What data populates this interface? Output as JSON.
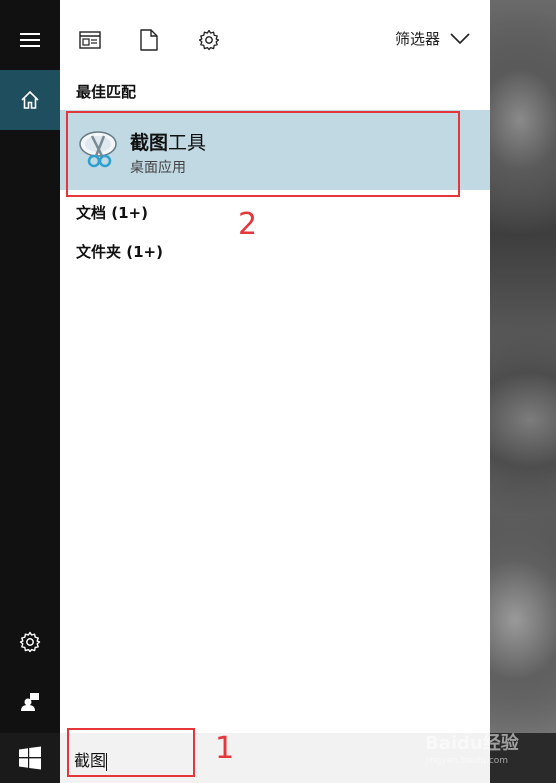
{
  "toolbar": {
    "filter_label": "筛选器"
  },
  "results": {
    "best_match_heading": "最佳匹配",
    "best_match": {
      "title_highlight": "截图",
      "title_rest": "工具",
      "subtitle": "桌面应用",
      "icon": "snipping-tool-icon"
    },
    "documents_heading": "文档 (1+)",
    "folders_heading": "文件夹 (1+)"
  },
  "search": {
    "value": "截图"
  },
  "annotations": {
    "step1": "1",
    "step2": "2",
    "color": "#e5373b"
  },
  "watermark": {
    "brand": "Baidu经验",
    "url": "jingyan.baidu.com"
  },
  "colors": {
    "rail": "#111111",
    "rail_active": "#1f4e5e",
    "selected_result": "#c0d9e3"
  }
}
